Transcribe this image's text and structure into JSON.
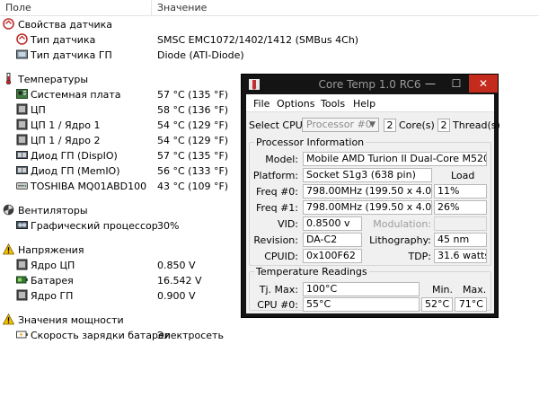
{
  "header": {
    "col_field": "Поле",
    "col_value": "Значение"
  },
  "rows": [
    {
      "kind": "section",
      "icon": "sensor-properties-icon",
      "name": "Свойства датчика",
      "value": ""
    },
    {
      "kind": "item",
      "icon": "sensor-type-icon",
      "name": "Тип датчика",
      "value": "SMSC EMC1072/1402/1412  (SMBus 4Ch)"
    },
    {
      "kind": "item",
      "icon": "gpu-sensor-type-icon",
      "name": "Тип датчика ГП",
      "value": "Diode  (ATI-Diode)"
    },
    {
      "kind": "gap"
    },
    {
      "kind": "section",
      "icon": "thermometer-icon",
      "name": "Температуры",
      "value": ""
    },
    {
      "kind": "item",
      "icon": "motherboard-icon",
      "name": "Системная плата",
      "value": "57 °C  (135 °F)"
    },
    {
      "kind": "item",
      "icon": "cpu-chip-icon",
      "name": "ЦП",
      "value": "58 °C  (136 °F)"
    },
    {
      "kind": "item",
      "icon": "cpu-chip-icon",
      "name": "ЦП 1 / Ядро 1",
      "value": "54 °C  (129 °F)"
    },
    {
      "kind": "item",
      "icon": "cpu-chip-icon",
      "name": "ЦП 1 / Ядро 2",
      "value": "54 °C  (129 °F)"
    },
    {
      "kind": "item",
      "icon": "gpu-diode-icon",
      "name": "Диод ГП (DispIO)",
      "value": "57 °C  (135 °F)"
    },
    {
      "kind": "item",
      "icon": "gpu-diode-icon",
      "name": "Диод ГП (MemIO)",
      "value": "56 °C  (133 °F)"
    },
    {
      "kind": "item",
      "icon": "hard-disk-icon",
      "name": "TOSHIBA MQ01ABD100",
      "value": "43 °C  (109 °F)"
    },
    {
      "kind": "gap"
    },
    {
      "kind": "section",
      "icon": "fan-icon",
      "name": "Вентиляторы",
      "value": ""
    },
    {
      "kind": "item",
      "icon": "graphics-card-icon",
      "name": "Графический процессор",
      "value": "30%"
    },
    {
      "kind": "gap"
    },
    {
      "kind": "section",
      "icon": "voltage-warning-icon",
      "name": "Напряжения",
      "value": ""
    },
    {
      "kind": "item",
      "icon": "cpu-chip-icon",
      "name": "Ядро ЦП",
      "value": "0.850 V"
    },
    {
      "kind": "item",
      "icon": "battery-icon",
      "name": "Батарея",
      "value": "16.542 V"
    },
    {
      "kind": "item",
      "icon": "cpu-chip-icon",
      "name": "Ядро ГП",
      "value": "0.900 V"
    },
    {
      "kind": "gap"
    },
    {
      "kind": "section",
      "icon": "power-warning-icon",
      "name": "Значения мощности",
      "value": ""
    },
    {
      "kind": "item",
      "icon": "battery-charge-icon",
      "name": "Скорость зарядки батареи",
      "value": "Электросеть"
    }
  ],
  "coretemp": {
    "title": "Core Temp 1.0 RC6",
    "controls": {
      "minimize": "—",
      "maximize": "☐",
      "close": "✕"
    },
    "menu": [
      "File",
      "Options",
      "Tools",
      "Help"
    ],
    "select_cpu_label": "Select CPU:",
    "cpu_dropdown": "Processor #0",
    "cores_value": "2",
    "cores_label": "Core(s)",
    "threads_value": "2",
    "threads_label": "Thread(s)",
    "processor_info": {
      "title": "Processor Information",
      "model_label": "Model:",
      "model": "Mobile AMD Turion II Dual-Core M520 (Caspian)",
      "platform_label": "Platform:",
      "platform": "Socket S1g3 (638 pin)",
      "load_label": "Load",
      "freq0_label": "Freq #0:",
      "freq0": "798.00MHz (199.50 x 4.0)",
      "load0": "11%",
      "freq1_label": "Freq #1:",
      "freq1": "798.00MHz (199.50 x 4.0)",
      "load1": "26%",
      "vid_label": "VID:",
      "vid": "0.8500 v",
      "modulation_label": "Modulation:",
      "modulation": "",
      "revision_label": "Revision:",
      "revision": "DA-C2",
      "lithography_label": "Lithography:",
      "lithography": "45 nm",
      "cpuid_label": "CPUID:",
      "cpuid": "0x100F62",
      "tdp_label": "TDP:",
      "tdp": "31.6 watts"
    },
    "temperature": {
      "title": "Temperature Readings",
      "tjmax_label": "Tj. Max:",
      "tjmax": "100°C",
      "min_label": "Min.",
      "max_label": "Max.",
      "cpu0_label": "CPU #0:",
      "cpu0": "55°C",
      "cpu0_min": "52°C",
      "cpu0_max": "71°C"
    }
  }
}
